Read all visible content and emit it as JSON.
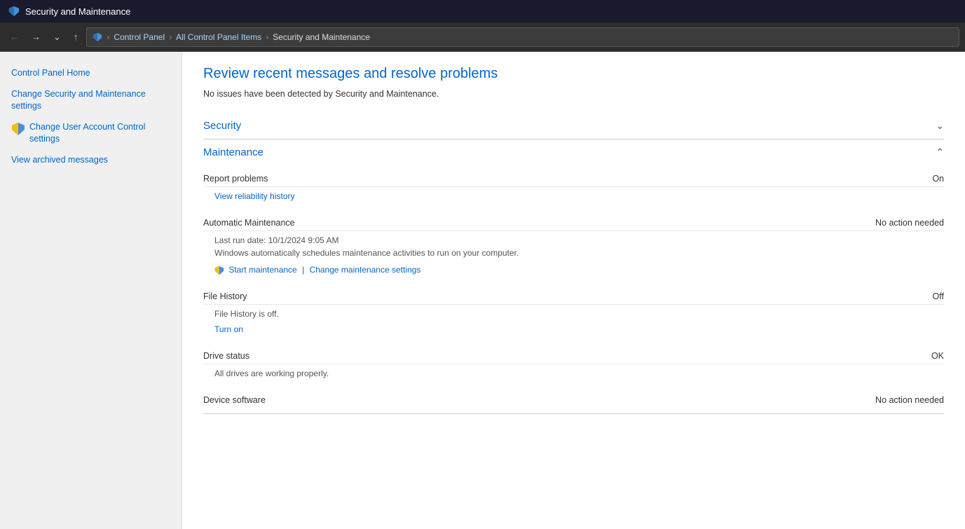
{
  "titleBar": {
    "icon": "🔒",
    "title": "Security and Maintenance"
  },
  "addressBar": {
    "pathParts": [
      {
        "label": "Control Panel",
        "clickable": true
      },
      {
        "label": "All Control Panel Items",
        "clickable": true
      },
      {
        "label": "Security and Maintenance",
        "clickable": false
      }
    ]
  },
  "sidebar": {
    "items": [
      {
        "id": "control-panel-home",
        "label": "Control Panel Home",
        "hasShield": false
      },
      {
        "id": "change-security-maintenance",
        "label": "Change Security and Maintenance settings",
        "hasShield": false
      },
      {
        "id": "change-uac",
        "label": "Change User Account Control settings",
        "hasShield": true
      },
      {
        "id": "view-archived",
        "label": "View archived messages",
        "hasShield": false
      }
    ]
  },
  "content": {
    "pageTitle": "Review recent messages and resolve problems",
    "subtitle": "No issues have been detected by Security and Maintenance.",
    "sections": [
      {
        "id": "security",
        "title": "Security",
        "expanded": false,
        "chevron": "˅"
      },
      {
        "id": "maintenance",
        "title": "Maintenance",
        "expanded": true,
        "chevron": "˄"
      }
    ],
    "maintenanceItems": [
      {
        "id": "report-problems",
        "label": "Report problems",
        "status": "On",
        "details": "",
        "links": [
          {
            "id": "reliability-history",
            "label": "View reliability history",
            "separator": null
          }
        ]
      },
      {
        "id": "automatic-maintenance",
        "label": "Automatic Maintenance",
        "status": "No action needed",
        "details": "Last run date: 10/1/2024 9:05 AM\nWindows automatically schedules maintenance activities to run on your computer.",
        "links": [
          {
            "id": "start-maintenance",
            "label": "Start maintenance",
            "separator": " | ",
            "hasShield": true
          },
          {
            "id": "change-maintenance-settings",
            "label": "Change maintenance settings",
            "separator": null,
            "hasShield": false
          }
        ]
      },
      {
        "id": "file-history",
        "label": "File History",
        "status": "Off",
        "details": "File History is off.",
        "links": [
          {
            "id": "turn-on",
            "label": "Turn on",
            "separator": null
          }
        ]
      },
      {
        "id": "drive-status",
        "label": "Drive status",
        "status": "OK",
        "details": "All drives are working properly.",
        "links": []
      },
      {
        "id": "device-software",
        "label": "Device software",
        "status": "No action needed",
        "details": "",
        "links": []
      }
    ]
  }
}
